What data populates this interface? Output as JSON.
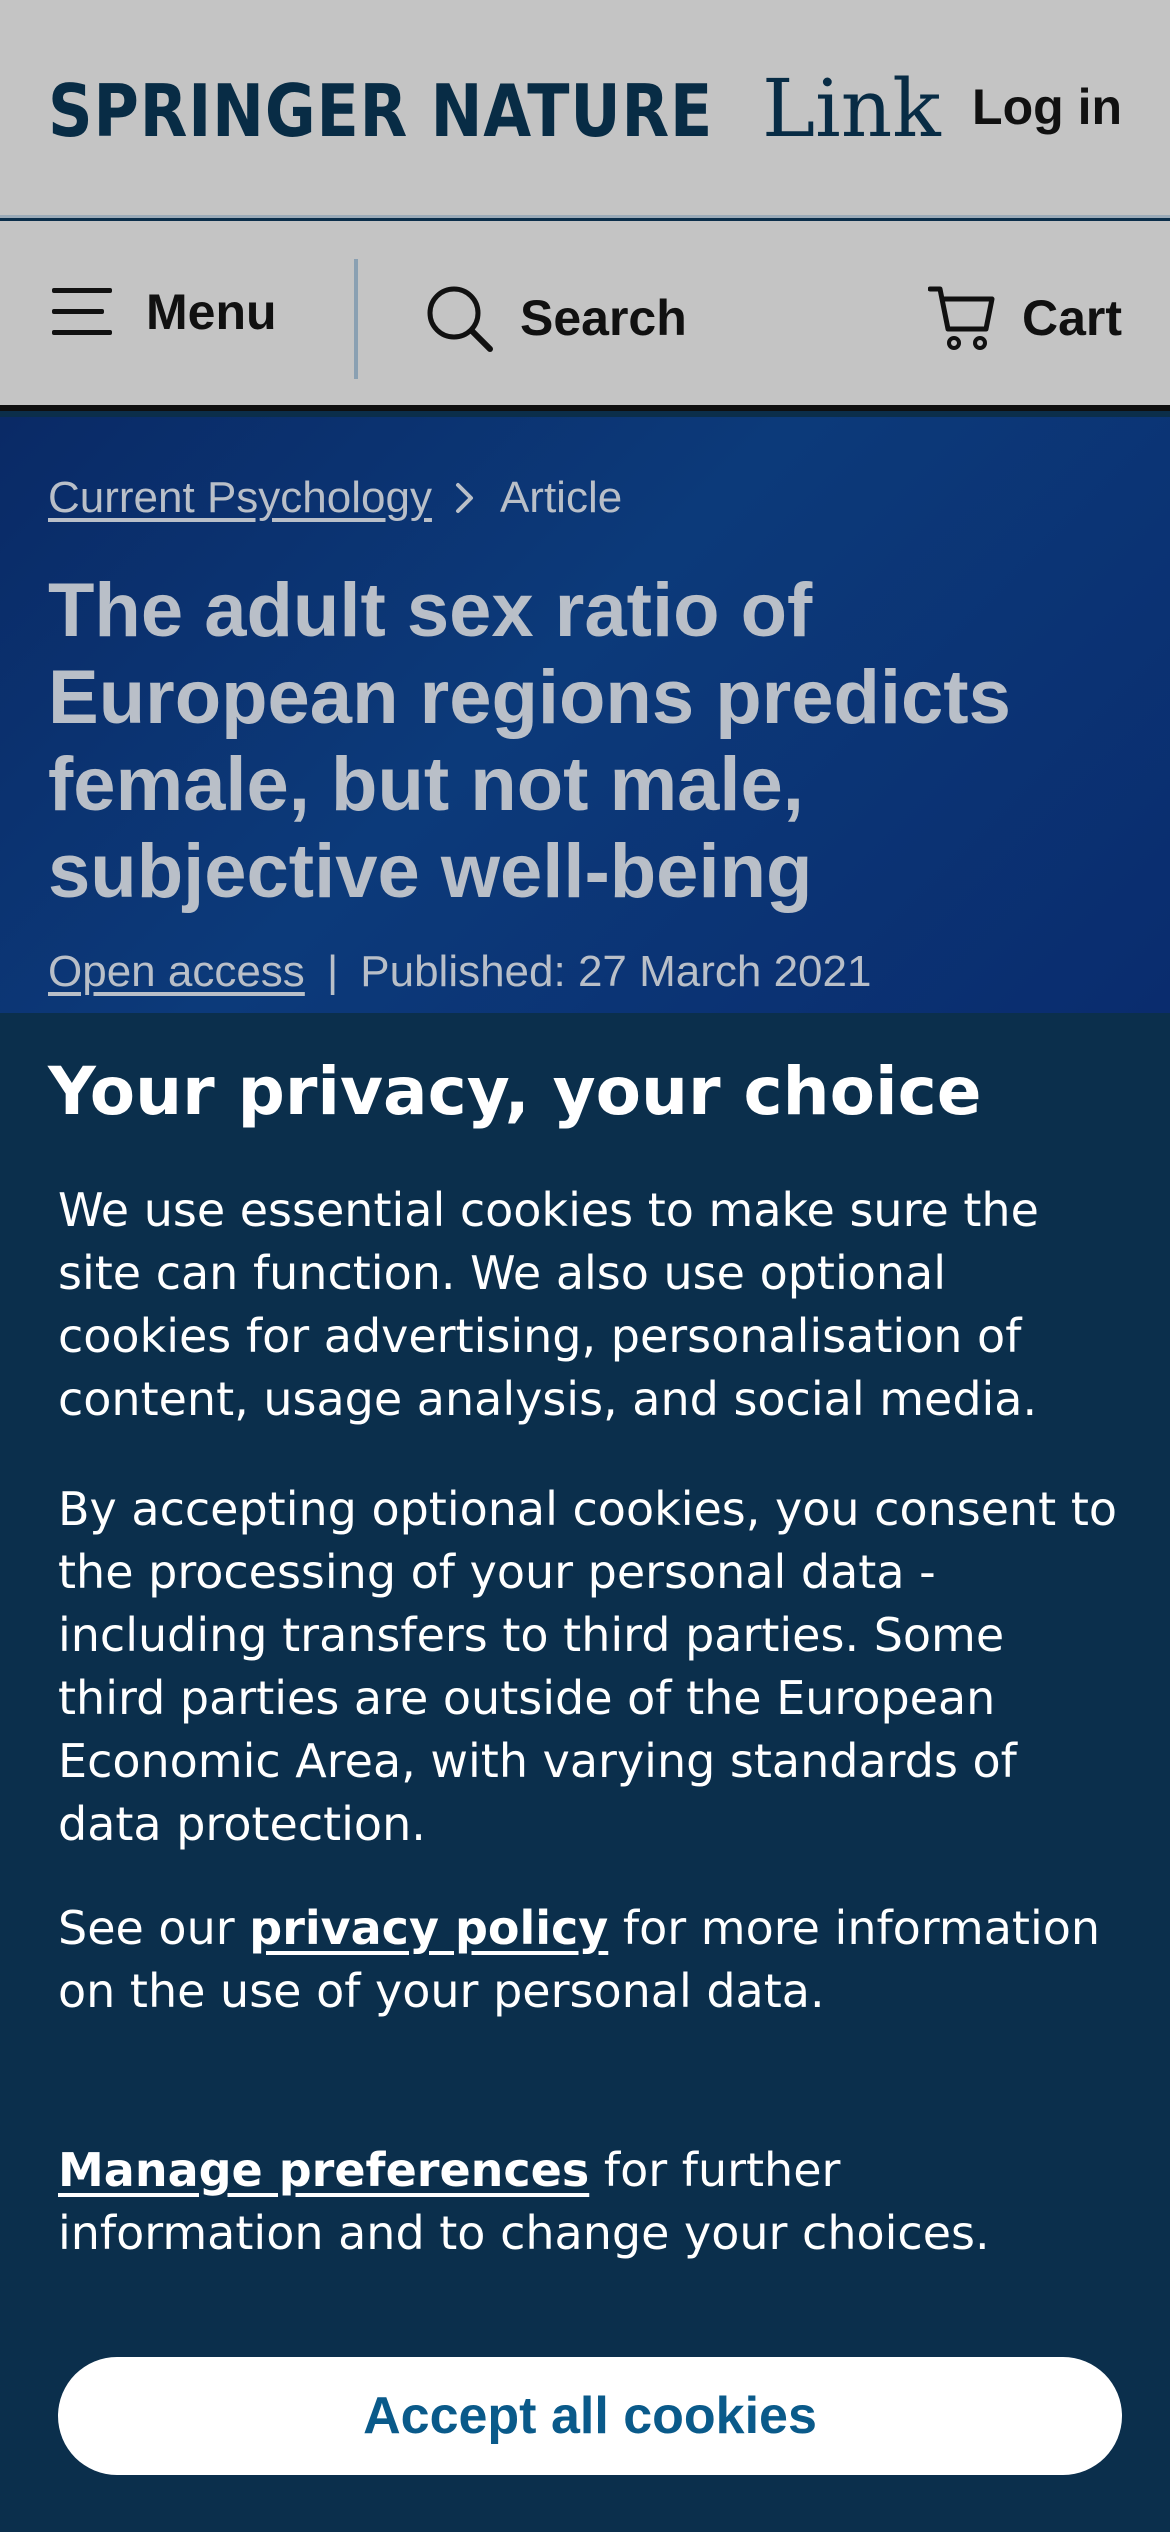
{
  "header": {
    "brand": "SPRINGER NATURE",
    "brand_sub": "Link",
    "login_label": "Log in"
  },
  "nav": {
    "menu_label": "Menu",
    "search_label": "Search",
    "cart_label": "Cart"
  },
  "article": {
    "breadcrumb": {
      "journal": "Current Psychology",
      "current": "Article"
    },
    "title": "The adult sex ratio of European regions predicts female, but not male, subjective well-being",
    "access": "Open access",
    "separator": "|",
    "published": "Published: 27 March 2021"
  },
  "consent": {
    "heading": "Your privacy, your choice",
    "p1": "We use essential cookies to make sure the site can function. We also use optional cookies for advertising, personalisation of content, usage analysis, and social media.",
    "p2": "By accepting optional cookies, you consent to the processing of your personal data - including transfers to third parties. Some third parties are outside of the European Economic Area, with varying standards of data protection.",
    "p3_before": "See our ",
    "privacy_link": "privacy policy",
    "p3_after": " for more information on the use of your personal data.",
    "manage_link": "Manage preferences",
    "p4_after": " for further information and to change your choices.",
    "accept_label": "Accept all cookies"
  },
  "colors": {
    "overlay_header_bg": "#c4c4c4",
    "hero_bg": "#0b3576",
    "consent_bg": "#0b2f4c",
    "accept_text": "#0a5a8a"
  }
}
